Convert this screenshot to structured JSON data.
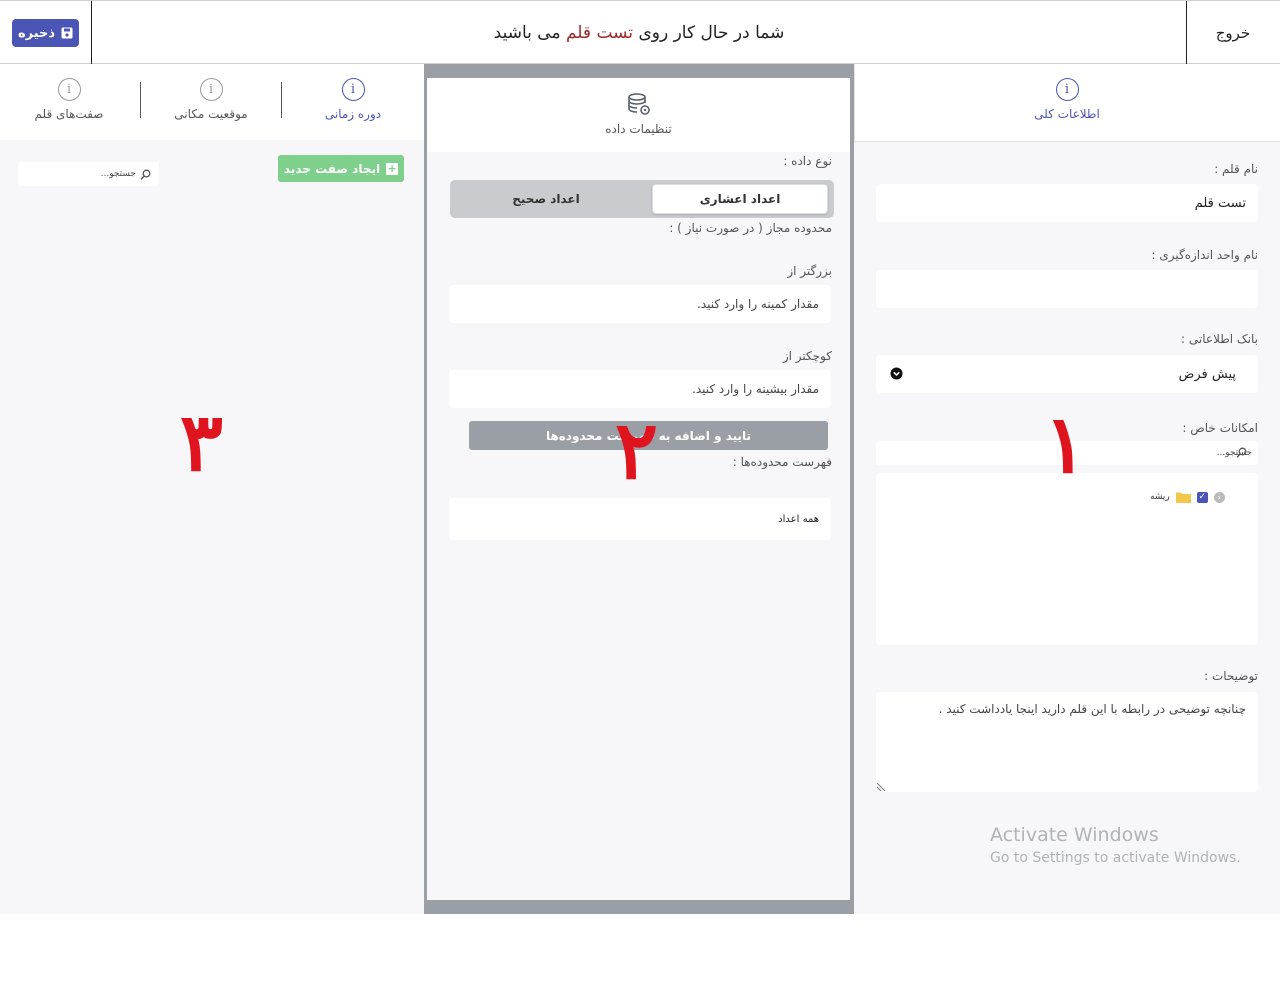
{
  "topbar": {
    "save_label": "ذخیره",
    "title_prefix": "شما در حال کار روی",
    "title_item": "تست قلم",
    "title_suffix": "می باشید",
    "exit_label": "خروج"
  },
  "right_panel": {
    "tab_general": "اطلاعات کلی",
    "name_label": "نام قلم :",
    "name_value": "تست قلم",
    "unit_label": "نام واحد اندازه‌گیری :",
    "unit_value": "",
    "db_label": "بانک اطلاعاتی :",
    "db_value": "پیش فرض",
    "features_label": "امکانات خاص :",
    "features_search_placeholder": "جستجو...",
    "tree_root": "ریشه",
    "tree_root_checked": true,
    "desc_label": "توضیحات :",
    "desc_placeholder": "چنانچه توضیحی در رابطه با این قلم دارید اینجا یادداشت کنید .",
    "marker": "۱"
  },
  "mid_panel": {
    "header_label": "تنظیمات داده",
    "datatype_label": "نوع داده :",
    "datatype_options": [
      "اعداد اعشاری",
      "اعداد صحیح"
    ],
    "datatype_selected": "اعداد اعشاری",
    "range_hint": "محدوده مجاز ( در صورت نیاز ) :",
    "greater_label": "بزرگتر از",
    "greater_placeholder": "مقدار کمینه را وارد کنید.",
    "less_label": "کوچکتر از",
    "less_placeholder": "مقدار بیشینه را وارد کنید.",
    "confirm_label": "تایید و اضافه به فهرست محدوده‌ها",
    "list_label": "فهرست محدوده‌ها :",
    "list_item": "همه اعداد",
    "marker": "۲"
  },
  "left_panel": {
    "tabs": [
      "دوره زمانی",
      "موقعیت مکانی",
      "صفت‌های قلم"
    ],
    "active_tab": "دوره زمانی",
    "new_attr_label": "ایجاد صفت جدید",
    "search_placeholder": "جستجو...",
    "marker": "۳"
  },
  "watermark": {
    "line1": "Activate Windows",
    "line2": "Go to Settings to activate Windows."
  },
  "colors": {
    "primary": "#4b55b5",
    "marker": "#e0141e",
    "success": "#7fcf8d",
    "highlight_title": "#9b2a2a"
  }
}
